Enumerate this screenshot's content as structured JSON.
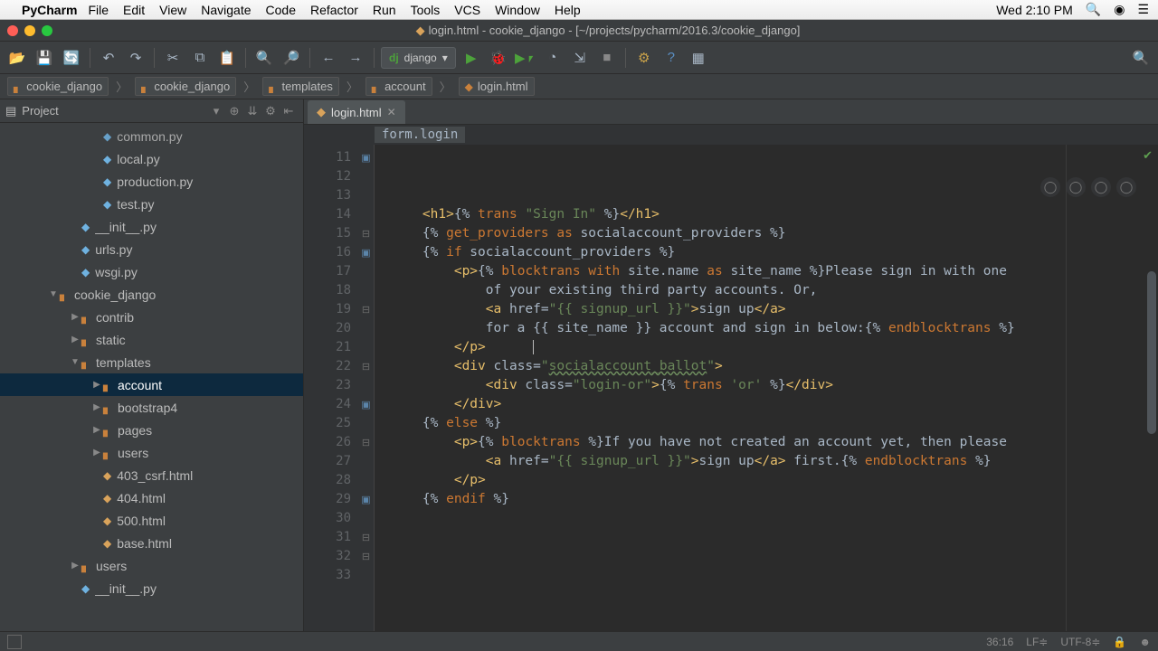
{
  "mac_menu": {
    "app": "PyCharm",
    "items": [
      "File",
      "Edit",
      "View",
      "Navigate",
      "Code",
      "Refactor",
      "Run",
      "Tools",
      "VCS",
      "Window",
      "Help"
    ],
    "clock": "Wed 2:10 PM"
  },
  "window": {
    "title": "login.html - cookie_django - [~/projects/pycharm/2016.3/cookie_django]"
  },
  "run_config": "django",
  "breadcrumbs": [
    "cookie_django",
    "cookie_django",
    "templates",
    "account",
    "login.html"
  ],
  "sidebar": {
    "title": "Project",
    "items": [
      {
        "depth": 3,
        "kind": "py",
        "label": "common.py",
        "cut": true
      },
      {
        "depth": 3,
        "kind": "py",
        "label": "local.py"
      },
      {
        "depth": 3,
        "kind": "py",
        "label": "production.py"
      },
      {
        "depth": 3,
        "kind": "py",
        "label": "test.py"
      },
      {
        "depth": 2,
        "kind": "py",
        "label": "__init__.py"
      },
      {
        "depth": 2,
        "kind": "py",
        "label": "urls.py"
      },
      {
        "depth": 2,
        "kind": "py",
        "label": "wsgi.py"
      },
      {
        "depth": 1,
        "kind": "folder",
        "label": "cookie_django",
        "tw": "down"
      },
      {
        "depth": 2,
        "kind": "folder",
        "label": "contrib",
        "tw": "right"
      },
      {
        "depth": 2,
        "kind": "folder",
        "label": "static",
        "tw": "right"
      },
      {
        "depth": 2,
        "kind": "folder",
        "label": "templates",
        "tw": "down"
      },
      {
        "depth": 3,
        "kind": "folder",
        "label": "account",
        "tw": "right",
        "sel": true
      },
      {
        "depth": 3,
        "kind": "folder",
        "label": "bootstrap4",
        "tw": "right"
      },
      {
        "depth": 3,
        "kind": "folder",
        "label": "pages",
        "tw": "right"
      },
      {
        "depth": 3,
        "kind": "folder",
        "label": "users",
        "tw": "right"
      },
      {
        "depth": 3,
        "kind": "html",
        "label": "403_csrf.html"
      },
      {
        "depth": 3,
        "kind": "html",
        "label": "404.html"
      },
      {
        "depth": 3,
        "kind": "html",
        "label": "500.html"
      },
      {
        "depth": 3,
        "kind": "html",
        "label": "base.html"
      },
      {
        "depth": 2,
        "kind": "folder",
        "label": "users",
        "tw": "right"
      },
      {
        "depth": 2,
        "kind": "py",
        "label": "__init__.py"
      }
    ]
  },
  "editor": {
    "tab_label": "login.html",
    "context": "form.login",
    "first_line": 11,
    "line_count": 23,
    "gutter_i18n": [
      11,
      16,
      24,
      29
    ],
    "gutter_fold": [
      15,
      19,
      22,
      26,
      31,
      32
    ],
    "cursor_line": 20,
    "lines_html": [
      "    <span class='c-tag'>&lt;h1&gt;</span>{% <span class='c-kw'>trans</span> <span class='c-str'>\"Sign In\"</span> %}<span class='c-tag'>&lt;/h1&gt;</span>",
      "",
      "    {% <span class='c-kw'>get_providers</span> <span class='c-kw'>as</span> socialaccount_providers %}",
      "",
      "    {% <span class='c-kw'>if</span> socialaccount_providers %}",
      "        <span class='c-tag'>&lt;p&gt;</span>{% <span class='c-kw'>blocktrans</span> <span class='c-kw'>with</span> site.name <span class='c-kw'>as</span> site_name %}Please sign in with one",
      "            of your existing third party accounts. Or,",
      "            <span class='c-tag'>&lt;a</span> <span class='c-attr'>href=</span><span class='c-str'>\"{{ signup_url }}\"</span><span class='c-tag'>&gt;</span>sign up<span class='c-tag'>&lt;/a&gt;</span>",
      "            for a {{ site_name }} account and sign in below:{% <span class='c-kw'>endblocktrans</span> %}",
      "        <span class='c-tag'>&lt;/p&gt;</span>      <span class='cursor'></span>",
      "",
      "        <span class='c-tag'>&lt;div</span> <span class='c-attr'>class=</span><span class='c-str'>\"</span><span class='c-cls'>socialaccount_ballot</span><span class='c-str'>\"</span><span class='c-tag'>&gt;</span>",
      "",
      "            <span class='c-tag'>&lt;div</span> <span class='c-attr'>class=</span><span class='c-str'>\"login-or\"</span><span class='c-tag'>&gt;</span>{% <span class='c-kw'>trans</span> <span class='c-str'>'or'</span> %}<span class='c-tag'>&lt;/div&gt;</span>",
      "",
      "        <span class='c-tag'>&lt;/div&gt;</span>",
      "",
      "    {% <span class='c-kw'>else</span> %}",
      "        <span class='c-tag'>&lt;p&gt;</span>{% <span class='c-kw'>blocktrans</span> %}If you have not created an account yet, then please",
      "            <span class='c-tag'>&lt;a</span> <span class='c-attr'>href=</span><span class='c-str'>\"{{ signup_url }}\"</span><span class='c-tag'>&gt;</span>sign up<span class='c-tag'>&lt;/a&gt;</span> first.{% <span class='c-kw'>endblocktrans</span> %}",
      "        <span class='c-tag'>&lt;/p&gt;</span>",
      "    {% <span class='c-kw'>endif</span> %}",
      ""
    ]
  },
  "status": {
    "pos": "36:16",
    "eol": "LF",
    "enc": "UTF-8"
  }
}
